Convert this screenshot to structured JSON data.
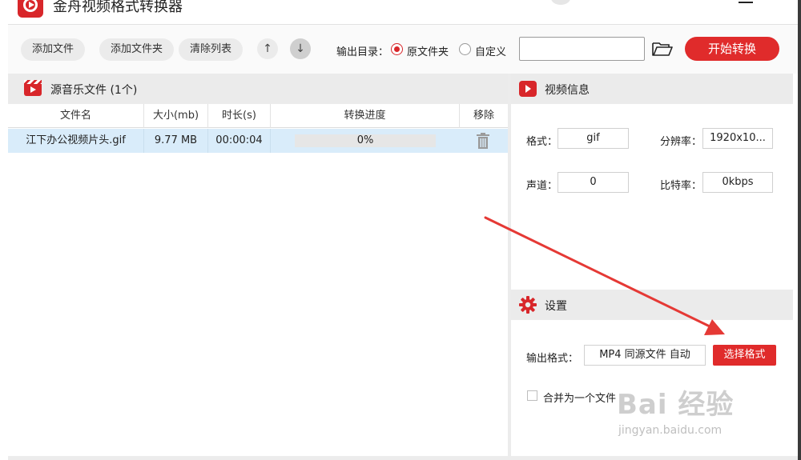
{
  "app": {
    "title": "金舟视频格式转换器"
  },
  "toolbar": {
    "add_file": "添加文件",
    "add_folder": "添加文件夹",
    "clear_list": "清除列表",
    "move_up": "↑",
    "move_down": "↓",
    "output_dir_label": "输出目录：",
    "radio_source": "原文件夹",
    "radio_custom": "自定义",
    "output_path_value": "",
    "start_button": "开始转换"
  },
  "file_list": {
    "header_title": "源音乐文件 (1个)",
    "columns": [
      "文件名",
      "大小(mb)",
      "时长(s)",
      "转换进度",
      "移除"
    ],
    "rows": [
      {
        "name": "江下办公视频片头.gif",
        "size": "9.77 MB",
        "duration": "00:00:04",
        "progress_text": "0%",
        "progress": 0
      }
    ]
  },
  "video_info": {
    "title": "视频信息",
    "format_label": "格式：",
    "format_value": "gif",
    "resolution_label": "分辨率：",
    "resolution_value": "1920x10...",
    "channel_label": "声道：",
    "channel_value": "0",
    "bitrate_label": "比特率：",
    "bitrate_value": "0kbps"
  },
  "settings": {
    "title": "设置",
    "output_format_label": "输出格式：",
    "output_format_value": "MP4 同源文件 自动",
    "choose_format_button": "选择格式",
    "merge_label": "合并为一个文件",
    "merge_checked": false
  },
  "watermark": {
    "brand": "Bai 经验",
    "site": "jingyan.baidu.com"
  },
  "colors": {
    "accent": "#e02b2b",
    "row_selected": "#d9ecfa",
    "panel_header": "#ebebeb"
  },
  "icons": [
    "app-logo-icon",
    "clapperboard-icon",
    "video-icon",
    "gear-icon",
    "folder-open-icon",
    "trash-icon",
    "arrow-up-icon",
    "arrow-down-icon"
  ]
}
